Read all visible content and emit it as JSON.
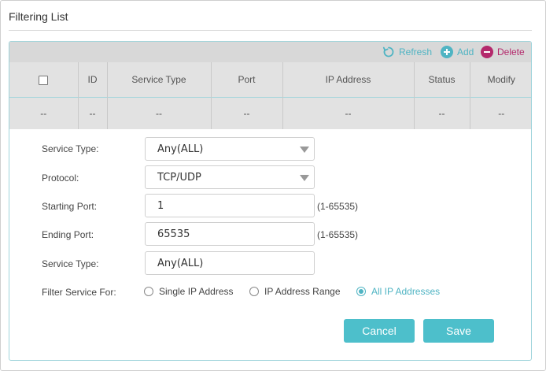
{
  "title": "Filtering List",
  "toolbar": {
    "refresh_label": "Refresh",
    "add_label": "Add",
    "delete_label": "Delete",
    "refresh_icon": "refresh-icon",
    "add_icon": "plus-circle-icon",
    "delete_icon": "minus-circle-icon",
    "accent_color": "#4fb4c3",
    "delete_color": "#b4296c"
  },
  "table": {
    "columns": [
      "ID",
      "Service Type",
      "Port",
      "IP Address",
      "Status",
      "Modify"
    ],
    "row": [
      "--",
      "--",
      "--",
      "--",
      "--",
      "--",
      "--"
    ]
  },
  "form": {
    "service_type_label": "Service Type:",
    "service_type_value": "Any(ALL)",
    "protocol_label": "Protocol:",
    "protocol_value": "TCP/UDP",
    "starting_port_label": "Starting Port:",
    "starting_port_value": "1",
    "starting_port_range": "(1-65535)",
    "ending_port_label": "Ending Port:",
    "ending_port_value": "65535",
    "ending_port_range": "(1-65535)",
    "service_type2_label": "Service Type:",
    "service_type2_value": "Any(ALL)",
    "filter_for_label": "Filter Service For:",
    "filter_options": [
      "Single IP Address",
      "IP Address Range",
      "All IP Addresses"
    ],
    "filter_selected": "All IP Addresses"
  },
  "buttons": {
    "cancel": "Cancel",
    "save": "Save",
    "button_color": "#4dbfcb"
  }
}
